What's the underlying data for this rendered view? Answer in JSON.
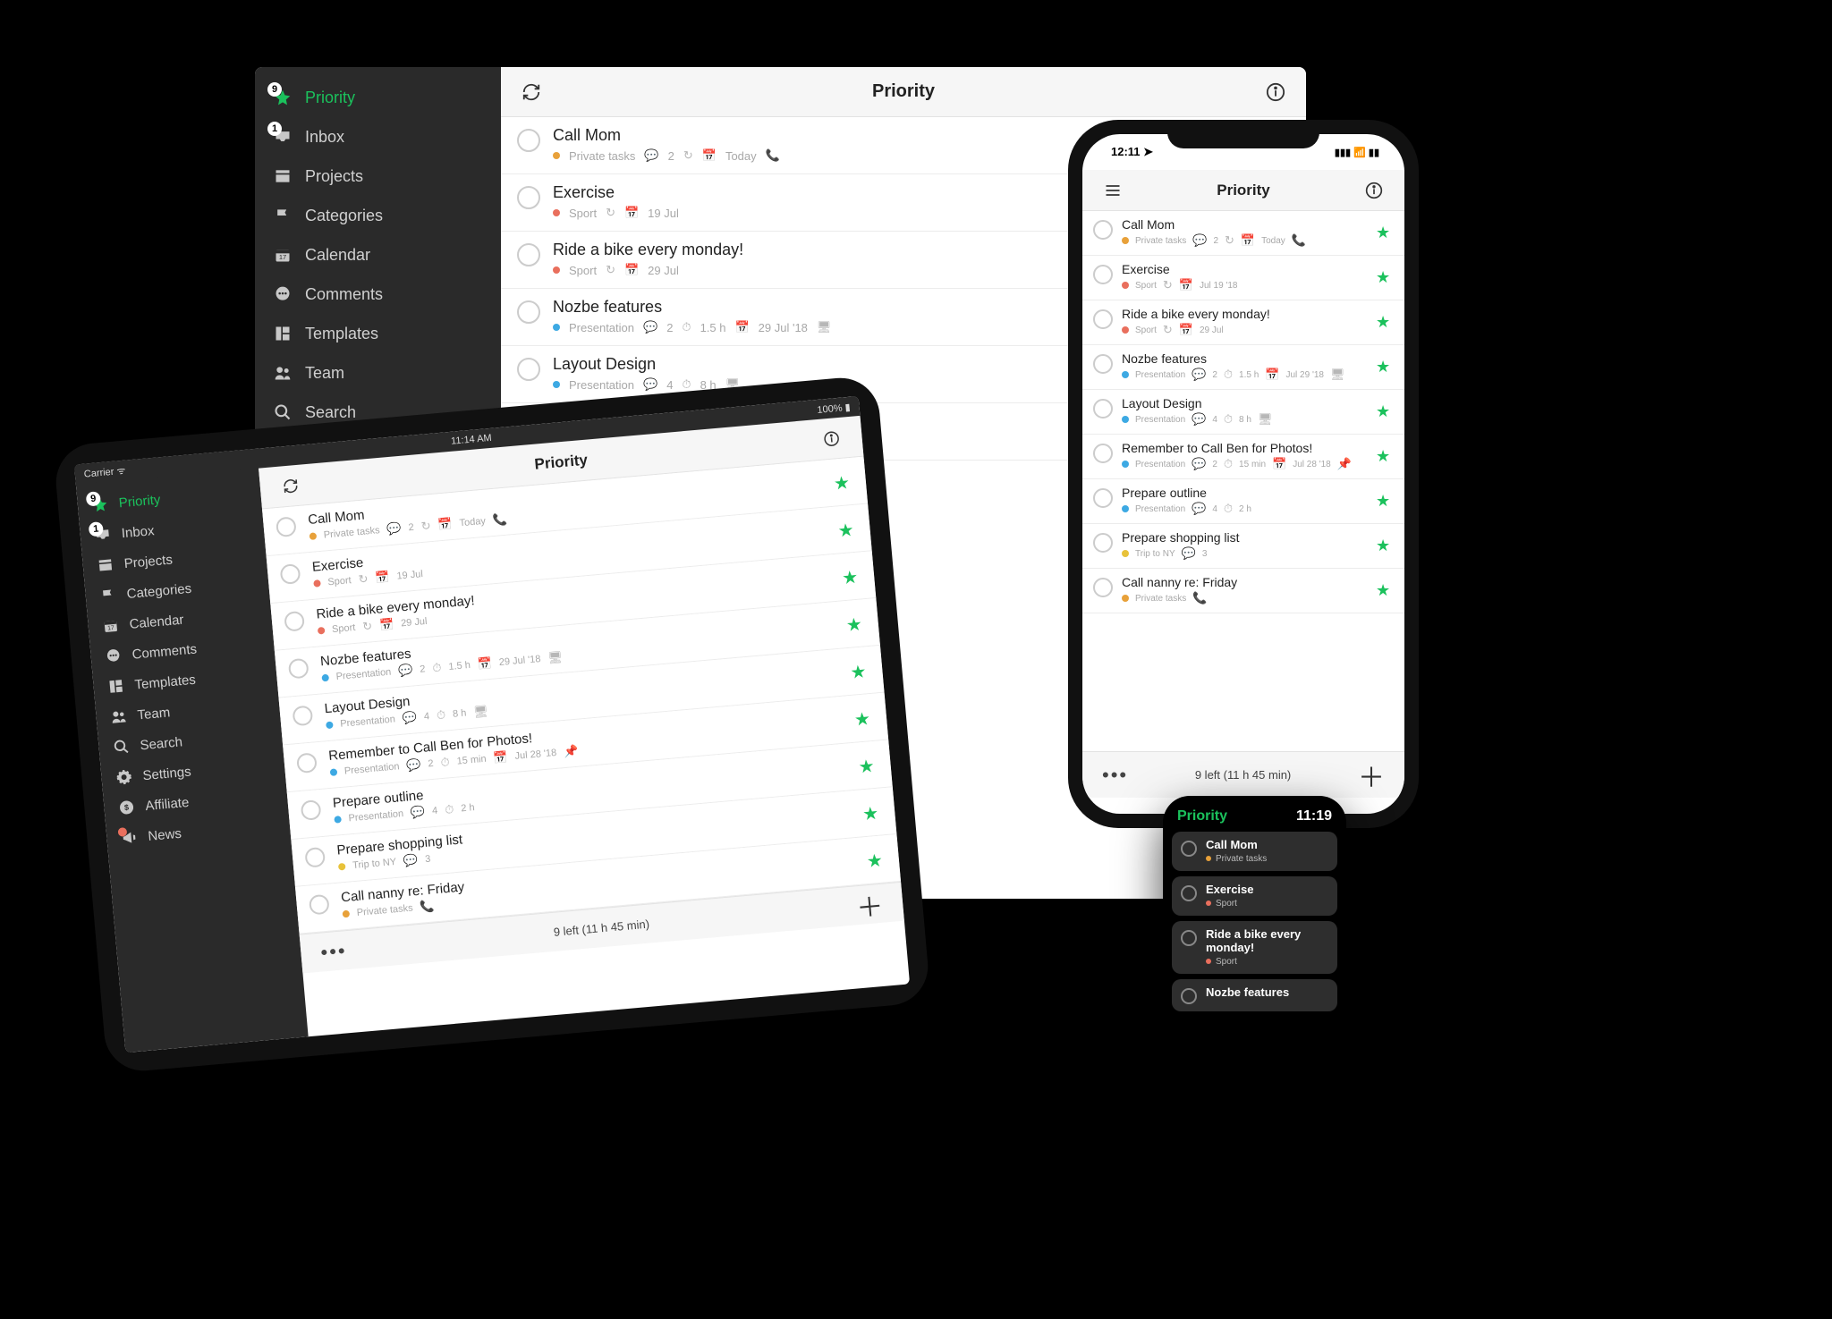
{
  "colors": {
    "green": "#1bc15c",
    "orange": "#e8a13a",
    "red": "#e96f5d",
    "blue": "#3da9e3",
    "yellow": "#e8c23a"
  },
  "header_title": "Priority",
  "sidebar": [
    {
      "key": "priority",
      "label": "Priority",
      "icon": "star-icon",
      "active": true,
      "badge": "9"
    },
    {
      "key": "inbox",
      "label": "Inbox",
      "icon": "inbox-icon",
      "active": false,
      "badge": "1"
    },
    {
      "key": "projects",
      "label": "Projects",
      "icon": "projects-icon",
      "active": false
    },
    {
      "key": "categories",
      "label": "Categories",
      "icon": "flag-icon",
      "active": false
    },
    {
      "key": "calendar",
      "label": "Calendar",
      "icon": "calendar-icon",
      "active": false
    },
    {
      "key": "comments",
      "label": "Comments",
      "icon": "comments-icon",
      "active": false
    },
    {
      "key": "templates",
      "label": "Templates",
      "icon": "templates-icon",
      "active": false
    },
    {
      "key": "team",
      "label": "Team",
      "icon": "team-icon",
      "active": false
    },
    {
      "key": "search",
      "label": "Search",
      "icon": "search-icon",
      "active": false
    },
    {
      "key": "settings",
      "label": "Settings",
      "icon": "gear-icon",
      "active": false
    }
  ],
  "sidebar_extra_ipad": [
    {
      "key": "affiliate",
      "label": "Affiliate",
      "icon": "dollar-icon"
    },
    {
      "key": "news",
      "label": "News",
      "icon": "megaphone-icon",
      "newdot": true
    }
  ],
  "tasks": [
    {
      "title": "Call Mom",
      "project": "Private tasks",
      "project_color": "#e8a13a",
      "meta": [
        {
          "icon": "chat",
          "val": "2"
        },
        {
          "icon": "repeat"
        },
        {
          "icon": "cal",
          "val": "Today"
        },
        {
          "icon": "phone"
        }
      ]
    },
    {
      "title": "Exercise",
      "project": "Sport",
      "project_color": "#e96f5d",
      "meta": [
        {
          "icon": "repeat"
        },
        {
          "icon": "cal",
          "val": "19 Jul"
        }
      ]
    },
    {
      "title": "Ride a bike every monday!",
      "project": "Sport",
      "project_color": "#e96f5d",
      "meta": [
        {
          "icon": "repeat"
        },
        {
          "icon": "cal",
          "val": "29 Jul"
        }
      ]
    },
    {
      "title": "Nozbe features",
      "project": "Presentation",
      "project_color": "#3da9e3",
      "meta": [
        {
          "icon": "chat",
          "val": "2"
        },
        {
          "icon": "clock",
          "val": "1.5 h"
        },
        {
          "icon": "cal",
          "val": "29 Jul '18"
        },
        {
          "icon": "screen"
        }
      ]
    },
    {
      "title": "Layout Design",
      "project": "Presentation",
      "project_color": "#3da9e3",
      "meta": [
        {
          "icon": "chat",
          "val": "4"
        },
        {
          "icon": "clock",
          "val": "8 h"
        },
        {
          "icon": "screen"
        }
      ]
    },
    {
      "title": "Remember to Call Ben for Photos!",
      "project": "Presentation",
      "project_color": "#3da9e3",
      "meta": [
        {
          "icon": "chat",
          "val": "2"
        },
        {
          "icon": "clock",
          "val": "15 min"
        },
        {
          "icon": "cal",
          "val": "Jul 28 '18"
        },
        {
          "icon": "pin"
        }
      ]
    },
    {
      "title": "Prepare outline",
      "project": "Presentation",
      "project_color": "#3da9e3",
      "meta": [
        {
          "icon": "chat",
          "val": "4"
        },
        {
          "icon": "clock",
          "val": "2 h"
        }
      ]
    },
    {
      "title": "Prepare shopping list",
      "project": "Trip to NY",
      "project_color": "#e8c23a",
      "meta": [
        {
          "icon": "chat",
          "val": "3"
        }
      ]
    },
    {
      "title": "Call nanny re: Friday",
      "project": "Private tasks",
      "project_color": "#e8a13a",
      "meta": [
        {
          "icon": "phone"
        }
      ]
    }
  ],
  "iphone_tasks_meta_overrides": {
    "1": [
      {
        "icon": "repeat"
      },
      {
        "icon": "cal",
        "val": "Jul 19 '18"
      }
    ],
    "3": [
      {
        "icon": "chat",
        "val": "2"
      },
      {
        "icon": "clock",
        "val": "1.5 h"
      },
      {
        "icon": "cal",
        "val": "Jul 29 '18"
      },
      {
        "icon": "screen"
      }
    ]
  },
  "summary": "9 left (11 h 45 min)",
  "ipad_status": {
    "left": "Carrier ᯤ",
    "center": "11:14 AM",
    "right": "100% ▮"
  },
  "iphone_status": {
    "left": "12:11 ➤",
    "right": "▮▮▮ 📶 ▮▮"
  },
  "watch": {
    "title": "Priority",
    "time": "11:19",
    "count": 4
  }
}
